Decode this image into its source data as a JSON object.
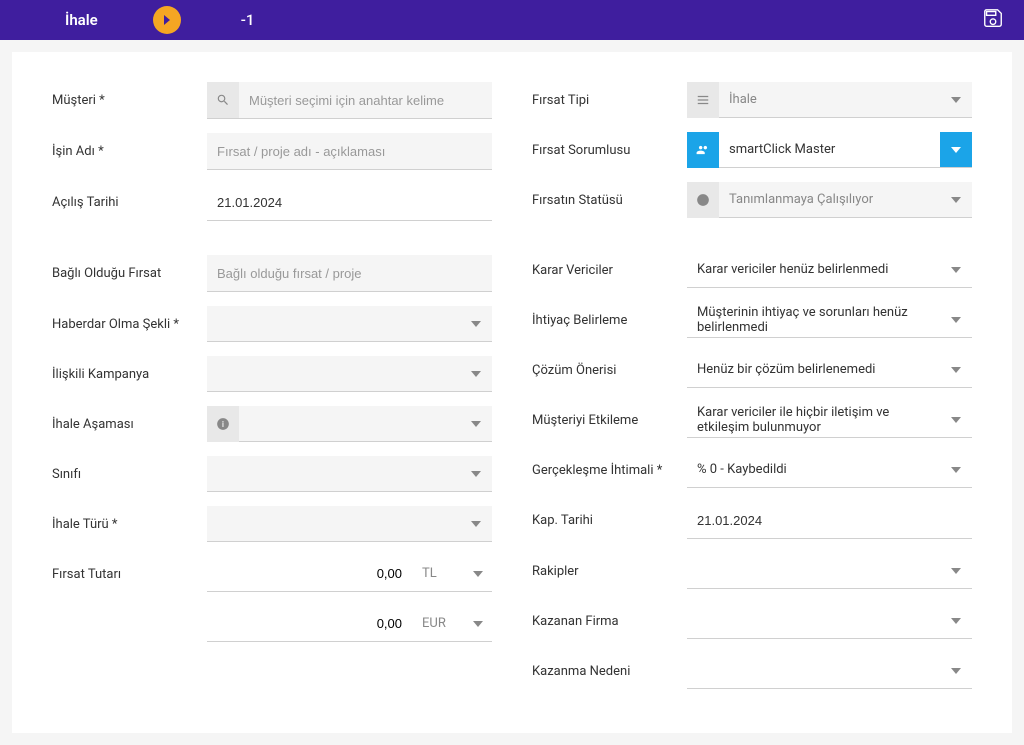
{
  "header": {
    "title": "İhale",
    "number": "-1"
  },
  "left": {
    "musteri": {
      "label": "Müşteri *",
      "placeholder": "Müşteri seçimi için anahtar kelime"
    },
    "isin_adi": {
      "label": "İşin Adı *",
      "placeholder": "Fırsat / proje adı - açıklaması"
    },
    "acilis_tarihi": {
      "label": "Açılış Tarihi",
      "value": "21.01.2024"
    },
    "bagli_firsat": {
      "label": "Bağlı Olduğu Fırsat",
      "placeholder": "Bağlı olduğu fırsat / proje"
    },
    "haberdar": {
      "label": "Haberdar Olma Şekli *"
    },
    "kampanya": {
      "label": "İlişkili Kampanya"
    },
    "asama": {
      "label": "İhale Aşaması"
    },
    "sinifi": {
      "label": "Sınıfı"
    },
    "turu": {
      "label": "İhale Türü *"
    },
    "tutari": {
      "label": "Fırsat Tutarı",
      "value1": "0,00",
      "cur1": "TL",
      "value2": "0,00",
      "cur2": "EUR"
    }
  },
  "right": {
    "tipi": {
      "label": "Fırsat Tipi",
      "value": "İhale"
    },
    "sorumlu": {
      "label": "Fırsat Sorumlusu",
      "value": "smartClick Master"
    },
    "statu": {
      "label": "Fırsatın Statüsü",
      "value": "Tanımlanmaya Çalışılıyor"
    },
    "karar": {
      "label": "Karar Vericiler",
      "value": "Karar vericiler henüz belirlenmedi"
    },
    "ihtiyac": {
      "label": "İhtiyaç Belirleme",
      "value": "Müşterinin ihtiyaç ve sorunları henüz belirlenmedi"
    },
    "cozum": {
      "label": "Çözüm Önerisi",
      "value": "Henüz bir çözüm belirlenemedi"
    },
    "etkileme": {
      "label": "Müşteriyi Etkileme",
      "value": "Karar vericiler ile hiçbir iletişim ve etkileşim bulunmuyor"
    },
    "ihtimal": {
      "label": "Gerçekleşme İhtimali *",
      "value": "% 0 - Kaybedildi"
    },
    "kap_tarihi": {
      "label": "Kap. Tarihi",
      "value": "21.01.2024"
    },
    "rakipler": {
      "label": "Rakipler"
    },
    "kazanan": {
      "label": "Kazanan Firma"
    },
    "neden": {
      "label": "Kazanma Nedeni"
    }
  }
}
